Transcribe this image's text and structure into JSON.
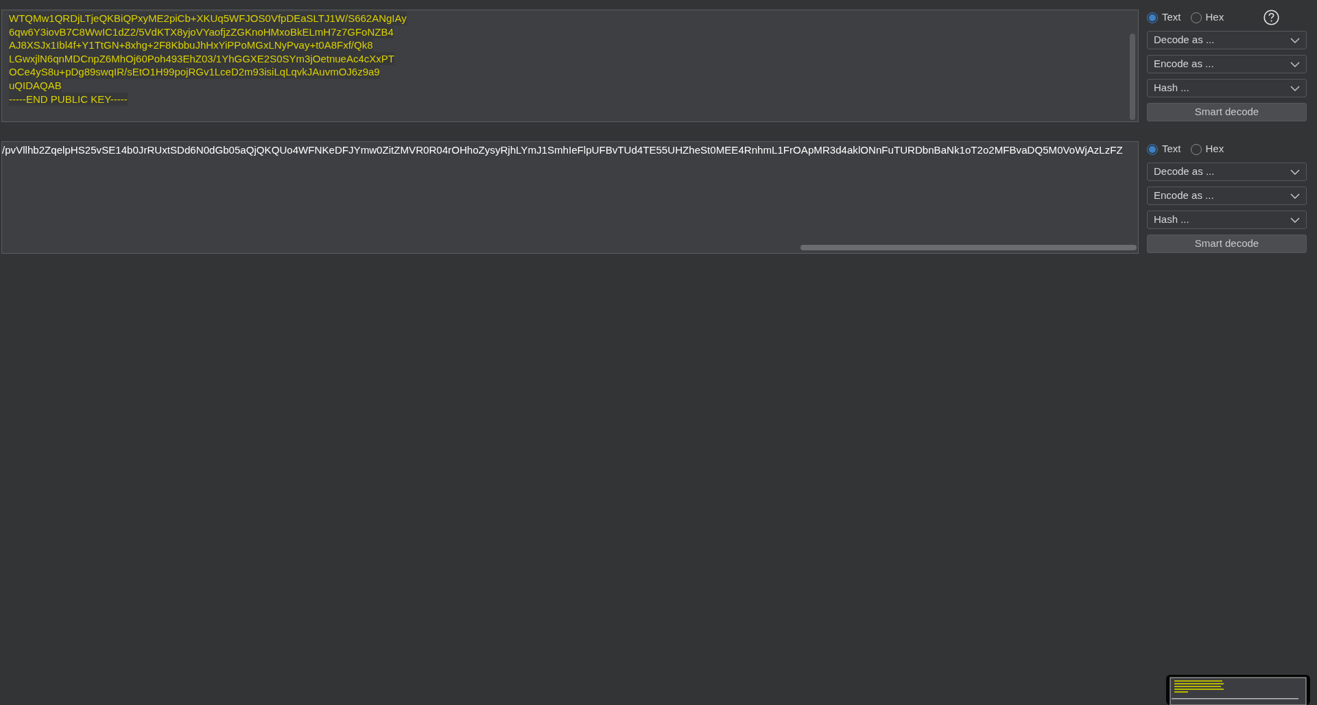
{
  "panes": [
    {
      "editor": {
        "lines": [
          "WTQMw1QRDjLTjeQKBiQPxyME2piCb+XKUq5WFJOS0VfpDEaSLTJ1W/S662ANgIAy",
          "6qw6Y3iovB7C8WwIC1dZ2/5VdKTX8yjoVYaofjzZGKnoHMxoBkELmH7z7GFoNZB4",
          "AJ8XSJx1Ibl4f+Y1TtGN+8xhg+2F8KbbuJhHxYiPPoMGxLNyPvay+t0A8Fxf/Qk8",
          "LGwxjlN6qnMDCnpZ6MhOj60Poh493EhZ03/1YhGGXE2S0SYm3jOetnueAc4cXxPT",
          "OCe4yS8u+pDg89swqIR/sEtO1H99pojRGv1LceD2m93isiLqLqvkJAuvmOJ6z9a9",
          "uQIDAQAB",
          "-----END PUBLIC KEY-----"
        ],
        "highlighted": true,
        "kind": "vertical"
      },
      "formats": [
        {
          "label": "Text",
          "selected": true
        },
        {
          "label": "Hex",
          "selected": false
        }
      ],
      "help": true,
      "dropdowns": [
        "Decode as ...",
        "Encode as ...",
        "Hash ..."
      ],
      "button": "Smart decode"
    },
    {
      "editor": {
        "lines": [
          "/pvVllhb2ZqelpHS25vSE14b0JrRUxtSDd6N0dGb05aQjQKQUo4WFNKeDFJYmw0ZitZMVR0R04rOHhoZysyRjhLYmJ1SmhIeFlpUFBvTUd4TE55UHZheSt0MEE4RnhmL1FrOApMR3d4aklONnFuTURDbnBaNk1oT2o2MFBvaDQ5M0VoWjAzLzFZ"
        ],
        "highlighted": false,
        "kind": "horizontal"
      },
      "formats": [
        {
          "label": "Text",
          "selected": true
        },
        {
          "label": "Hex",
          "selected": false
        }
      ],
      "help": false,
      "dropdowns": [
        "Decode as ...",
        "Encode as ...",
        "Hash ..."
      ],
      "button": "Smart decode"
    }
  ]
}
